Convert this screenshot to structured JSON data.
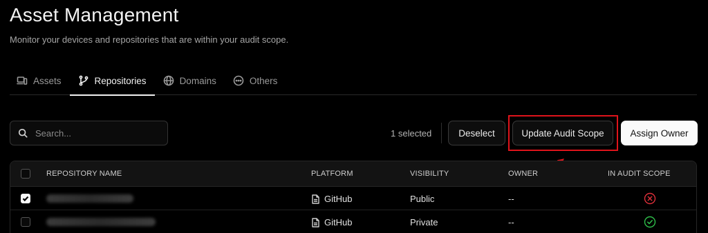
{
  "header": {
    "title": "Asset Management",
    "subtitle": "Monitor your devices and repositories that are within your audit scope."
  },
  "tabs": [
    {
      "label": "Assets",
      "icon": "devices-icon",
      "active": false
    },
    {
      "label": "Repositories",
      "icon": "git-branch-icon",
      "active": true
    },
    {
      "label": "Domains",
      "icon": "globe-icon",
      "active": false
    },
    {
      "label": "Others",
      "icon": "ellipsis-circle-icon",
      "active": false
    }
  ],
  "toolbar": {
    "search_placeholder": "Search...",
    "selected_text": "1 selected",
    "deselect_label": "Deselect",
    "update_label": "Update Audit Scope",
    "assign_label": "Assign Owner"
  },
  "table": {
    "columns": [
      "REPOSITORY NAME",
      "PLATFORM",
      "VISIBILITY",
      "OWNER",
      "IN AUDIT SCOPE"
    ],
    "rows": [
      {
        "checked": true,
        "platform": "GitHub",
        "visibility": "Public",
        "owner": "--",
        "in_audit_scope": false
      },
      {
        "checked": false,
        "platform": "GitHub",
        "visibility": "Private",
        "owner": "--",
        "in_audit_scope": true
      }
    ]
  },
  "colors": {
    "background": "#000000",
    "annotation_red": "#e0141b",
    "scope_no": "#e0303a",
    "scope_yes": "#2fbf4a"
  }
}
